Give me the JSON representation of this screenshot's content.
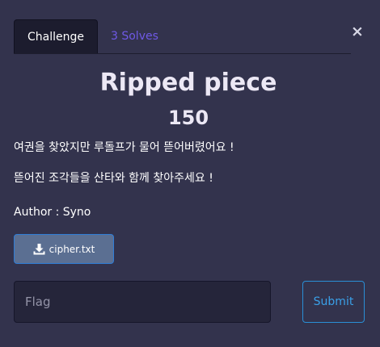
{
  "tabs": {
    "challenge_label": "Challenge",
    "solves_label": "3 Solves"
  },
  "close_glyph": "×",
  "challenge": {
    "title": "Ripped piece",
    "points": "150",
    "description": [
      "여권을 찾았지만 루돌프가 물어 뜯어버렸어요 !",
      "뜯어진 조각들을 산타와 함께 찾아주세요 !"
    ],
    "author": "Author : Syno"
  },
  "file": {
    "icon": "download-icon",
    "label": "cipher.txt"
  },
  "form": {
    "flag_placeholder": "Flag",
    "submit_label": "Submit"
  },
  "colors": {
    "background": "#33334d",
    "accent_purple": "#6f59e6",
    "submit_blue": "#3aa0e8",
    "file_button": "#5b6f92"
  }
}
